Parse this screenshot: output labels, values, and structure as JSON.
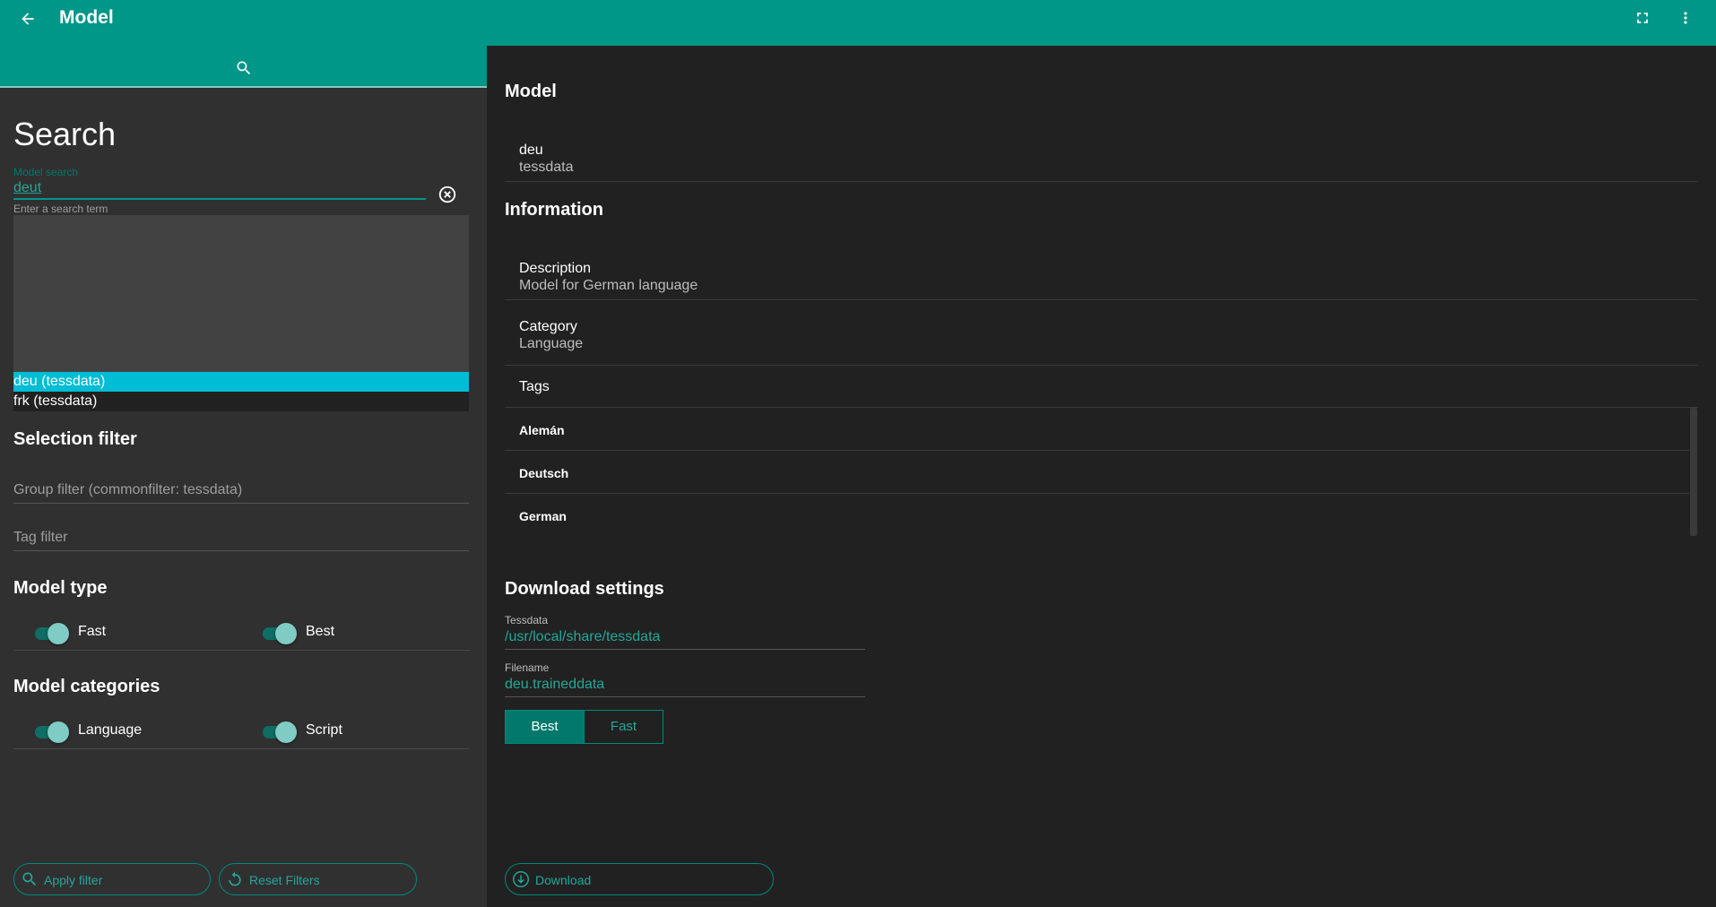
{
  "appbar": {
    "title": "Model",
    "back_icon": "arrow-back-icon",
    "fullscreen_icon": "fullscreen-icon",
    "more_icon": "more-vert-icon",
    "color": "#009688"
  },
  "left": {
    "tab_icon": "search-icon",
    "heading": "Search",
    "search": {
      "label": "Model search",
      "value": "deut",
      "hint": "Enter a search term"
    },
    "dropdown": {
      "items": [
        "deu (tessdata)",
        "frk (tessdata)"
      ],
      "selected_index": 0
    },
    "selection_filter": {
      "heading": "Selection filter",
      "group_filter_placeholder": "Group filter (commonfilter: tessdata)",
      "tag_filter_placeholder": "Tag filter"
    },
    "model_type": {
      "heading": "Model type",
      "toggles": [
        {
          "label": "Fast",
          "on": true
        },
        {
          "label": "Best",
          "on": true
        }
      ]
    },
    "model_categories": {
      "heading": "Model categories",
      "toggles": [
        {
          "label": "Language",
          "on": true
        },
        {
          "label": "Script",
          "on": true
        }
      ]
    },
    "buttons": {
      "apply": "Apply filter",
      "reset": "Reset Filters"
    }
  },
  "right": {
    "model_heading": "Model",
    "model": {
      "name": "deu",
      "source": "tessdata"
    },
    "information_heading": "Information",
    "description": {
      "label": "Description",
      "value": "Model for German language"
    },
    "category": {
      "label": "Category",
      "value": "Language"
    },
    "tags_label": "Tags",
    "tags": [
      "Alemán",
      "Deutsch",
      "German"
    ],
    "download_heading": "Download settings",
    "tessdata": {
      "label": "Tessdata",
      "value": "/usr/local/share/tessdata"
    },
    "filename": {
      "label": "Filename",
      "value": "deu.traineddata"
    },
    "segments": {
      "best": "Best",
      "fast": "Fast",
      "selected": "Best"
    },
    "download_button": "Download"
  }
}
